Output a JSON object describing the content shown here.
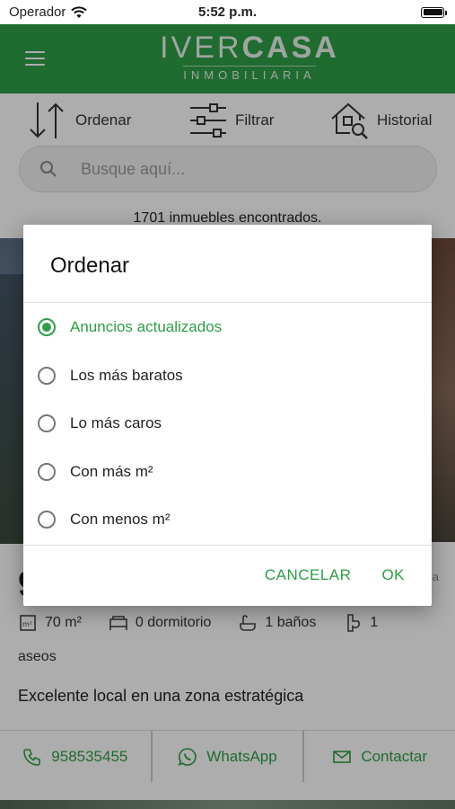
{
  "status_bar": {
    "carrier": "Operador",
    "time": "5:52 p.m."
  },
  "header": {
    "logo_main_thin": "IVER",
    "logo_main_bold": "CASA",
    "logo_sub": "INMOBILIARIA"
  },
  "toolbar": {
    "sort_label": "Ordenar",
    "filter_label": "Filtrar",
    "history_label": "Historial"
  },
  "search": {
    "placeholder": "Busque aquí..."
  },
  "results": {
    "count_text": "1701 inmuebles encontrados."
  },
  "listing": {
    "price_partial": "9",
    "ref_partial": "a",
    "features": {
      "area": "70 m²",
      "bedrooms": "0 dormitorio",
      "bathrooms": "1 baños",
      "toilets_count": "1",
      "toilets_label": "aseos"
    },
    "description": "Excelente local en una zona estratégica",
    "contact": {
      "phone": "958535455",
      "whatsapp": "WhatsApp",
      "contact": "Contactar"
    }
  },
  "dialog": {
    "title": "Ordenar",
    "options": [
      {
        "label": "Anuncios actualizados",
        "selected": true
      },
      {
        "label": "Los más baratos",
        "selected": false
      },
      {
        "label": "Lo más caros",
        "selected": false
      },
      {
        "label": "Con más m²",
        "selected": false
      },
      {
        "label": "Con menos m²",
        "selected": false
      }
    ],
    "cancel_label": "CANCELAR",
    "ok_label": "OK"
  },
  "colors": {
    "brand_green": "#2e9e47",
    "overlay": "rgba(0,0,0,0.32)"
  }
}
